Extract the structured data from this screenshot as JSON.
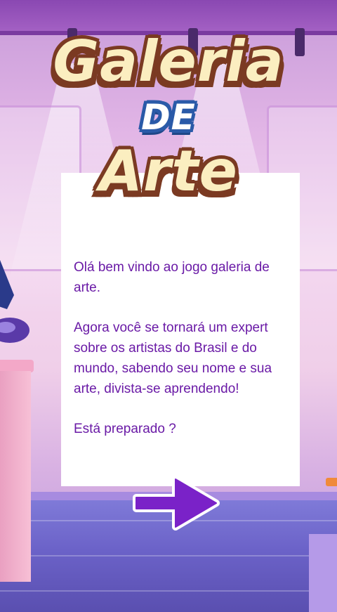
{
  "title": {
    "line1": "Galeria",
    "line2": "DE",
    "line3": "Arte"
  },
  "intro": {
    "greeting": "Olá bem vindo ao jogo galeria de arte.",
    "description": "Agora você se tornará um expert sobre os artistas do Brasil e do mundo, sabendo seu nome e sua arte, divista-se aprendendo!",
    "question": "Está preparado ?"
  },
  "next_button": {
    "icon": "arrow-right-icon",
    "color": "#7a22c8"
  },
  "colors": {
    "text": "#6a1aa6",
    "title_fill": "#fbeec0",
    "title_outline": "#7b3a22"
  }
}
